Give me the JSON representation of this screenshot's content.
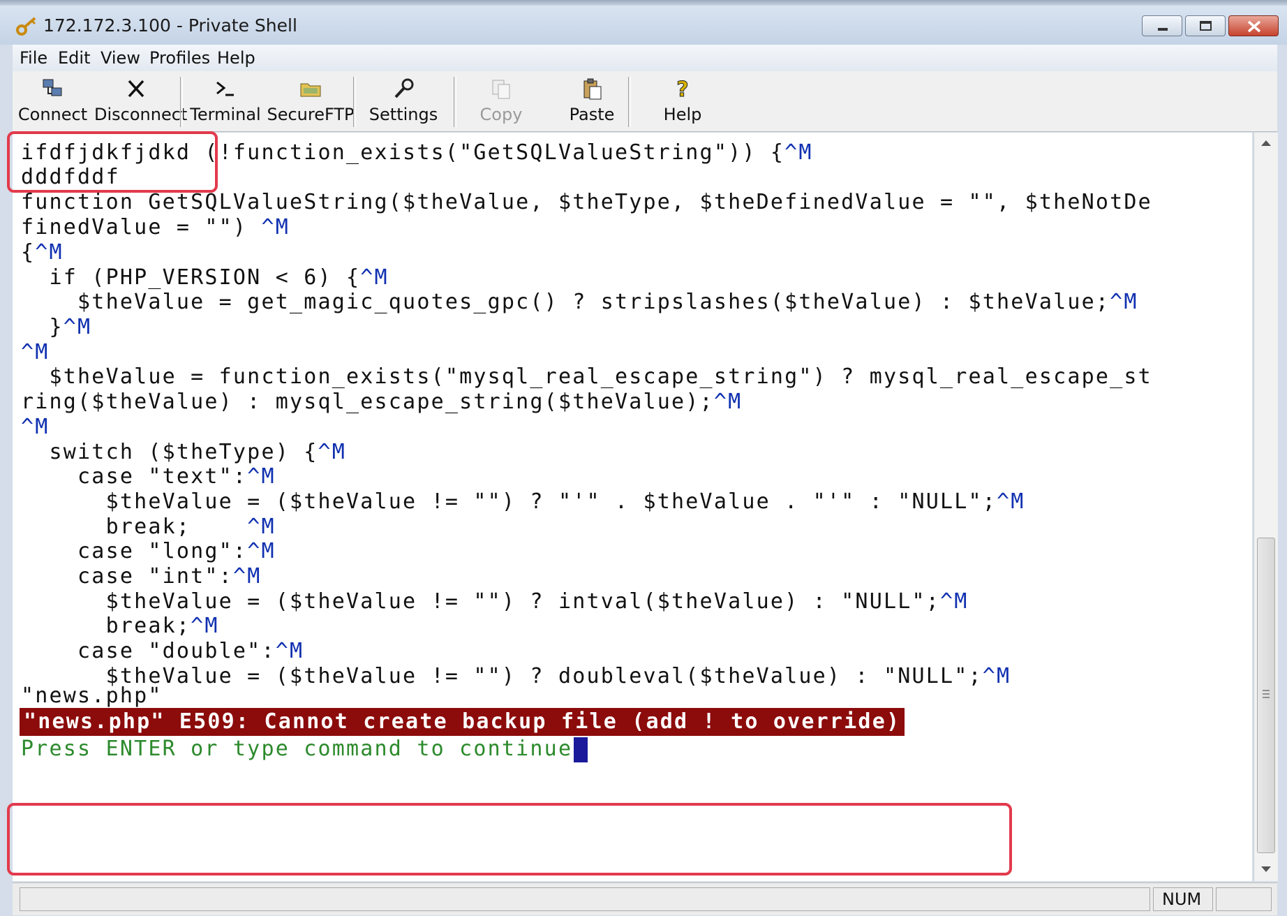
{
  "window": {
    "title": "172.172.3.100 - Private Shell"
  },
  "menu": {
    "items": [
      "File",
      "Edit",
      "View",
      "Profiles",
      "Help"
    ]
  },
  "toolbar": {
    "buttons": [
      {
        "label": "Connect",
        "icon": "connect-icon",
        "enabled": true
      },
      {
        "label": "Disconnect",
        "icon": "disconnect-icon",
        "enabled": true
      },
      {
        "label": "Terminal",
        "icon": "terminal-icon",
        "enabled": true
      },
      {
        "label": "SecureFTP",
        "icon": "folder-icon",
        "enabled": true
      },
      {
        "label": "Settings",
        "icon": "wrench-icon",
        "enabled": true
      },
      {
        "label": "Copy",
        "icon": "copy-icon",
        "enabled": false
      },
      {
        "label": "Paste",
        "icon": "paste-icon",
        "enabled": true
      },
      {
        "label": "Help",
        "icon": "help-icon",
        "enabled": true
      }
    ]
  },
  "terminal": {
    "lines": [
      {
        "text": "ifdfjdkfjdkd (!function_exists(\"GetSQLValueString\")) {",
        "ctl": "^M"
      },
      {
        "text": "dddfddf",
        "ctl": ""
      },
      {
        "text": "function GetSQLValueString($theValue, $theType, $theDefinedValue = \"\", $theNotDe",
        "ctl": ""
      },
      {
        "text": "finedValue = \"\") ",
        "ctl": "^M"
      },
      {
        "text": "{",
        "ctl": "^M"
      },
      {
        "text": "  if (PHP_VERSION < 6) {",
        "ctl": "^M"
      },
      {
        "text": "    $theValue = get_magic_quotes_gpc() ? stripslashes($theValue) : $theValue;",
        "ctl": "^M"
      },
      {
        "text": "  }",
        "ctl": "^M"
      },
      {
        "text": "",
        "ctl": "^M"
      },
      {
        "text": "  $theValue = function_exists(\"mysql_real_escape_string\") ? mysql_real_escape_st",
        "ctl": ""
      },
      {
        "text": "ring($theValue) : mysql_escape_string($theValue);",
        "ctl": "^M"
      },
      {
        "text": "",
        "ctl": "^M"
      },
      {
        "text": "  switch ($theType) {",
        "ctl": "^M"
      },
      {
        "text": "    case \"text\":",
        "ctl": "^M"
      },
      {
        "text": "      $theValue = ($theValue != \"\") ? \"'\" . $theValue . \"'\" : \"NULL\";",
        "ctl": "^M"
      },
      {
        "text": "      break;    ",
        "ctl": "^M"
      },
      {
        "text": "    case \"long\":",
        "ctl": "^M"
      },
      {
        "text": "    case \"int\":",
        "ctl": "^M"
      },
      {
        "text": "      $theValue = ($theValue != \"\") ? intval($theValue) : \"NULL\";",
        "ctl": "^M"
      },
      {
        "text": "      break;",
        "ctl": "^M"
      },
      {
        "text": "    case \"double\":",
        "ctl": "^M"
      },
      {
        "text": "      $theValue = ($theValue != \"\") ? doubleval($theValue) : \"NULL\";",
        "ctl": "^M"
      },
      {
        "text": "\"news.php\"",
        "ctl": ""
      }
    ],
    "error_message": "\"news.php\" E509: Cannot create backup file (add ! to override)",
    "prompt_message": "Press ENTER or type command to continue"
  },
  "status": {
    "mode": "NUM"
  },
  "colors": {
    "highlight_box": "#e23a4c",
    "error_bg": "#8c0b0b",
    "prompt_fg": "#2c8a2c",
    "control_char": "#1030b0"
  }
}
